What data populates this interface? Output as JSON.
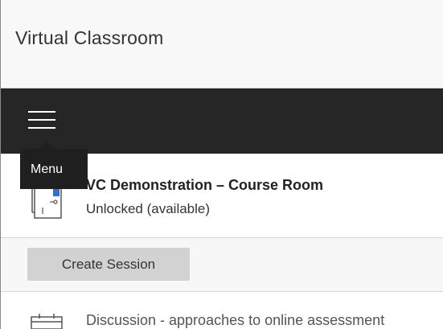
{
  "app": {
    "title": "Virtual Classroom"
  },
  "nav": {
    "menu_tooltip": "Menu",
    "menu_icon": "hamburger-menu-icon"
  },
  "room": {
    "name": "VC Demonstration – Course Room",
    "status": "Unlocked (available)",
    "icon": "door-icon"
  },
  "actions": {
    "create_session_label": "Create Session"
  },
  "sessions": [
    {
      "title": "Discussion - approaches to online assessment",
      "icon": "calendar-icon"
    }
  ],
  "colors": {
    "nav_background": "#262626",
    "tooltip_background": "#1f1f1f",
    "button_background": "#d2d2d2",
    "door_accent": "#2f6fd6"
  }
}
